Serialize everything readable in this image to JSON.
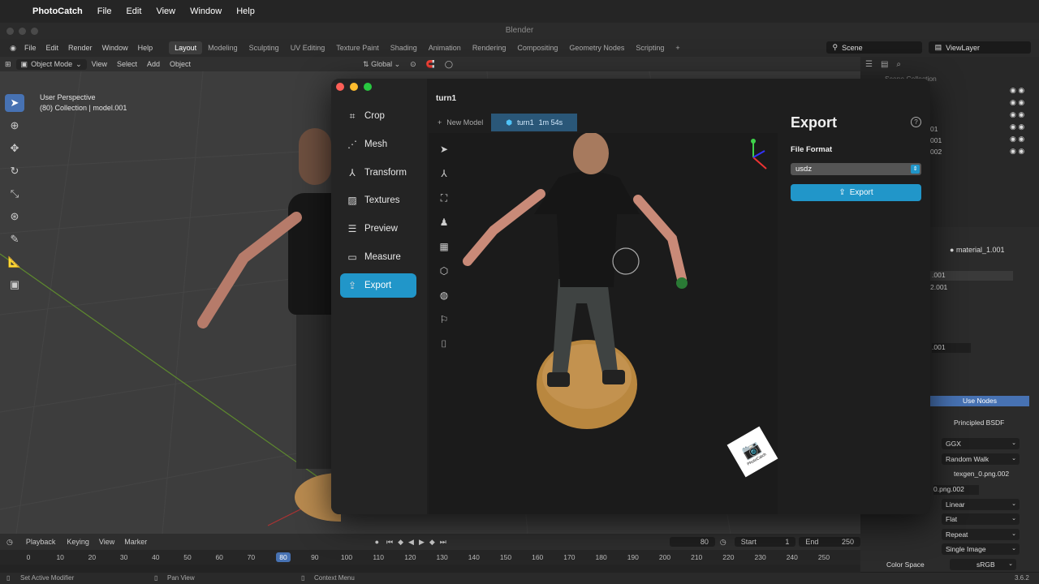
{
  "mac": {
    "app_name": "PhotoCatch",
    "menu": [
      "File",
      "Edit",
      "View",
      "Window",
      "Help"
    ]
  },
  "blender": {
    "window_title": "Blender",
    "menu": [
      "File",
      "Edit",
      "Render",
      "Window",
      "Help"
    ],
    "workspaces": [
      "Layout",
      "Modeling",
      "Sculpting",
      "UV Editing",
      "Texture Paint",
      "Shading",
      "Animation",
      "Rendering",
      "Compositing",
      "Geometry Nodes",
      "Scripting"
    ],
    "active_workspace": "Layout",
    "scene": "Scene",
    "view_layer": "ViewLayer",
    "viewport_header": {
      "mode": "Object Mode",
      "menus": [
        "View",
        "Select",
        "Add",
        "Object"
      ],
      "orientation": "Global"
    },
    "viewport_info": {
      "line1": "User Perspective",
      "line2": "(80) Collection | model.001"
    },
    "outliner": {
      "title": "Scene Collection",
      "rows": [
        "01",
        "001",
        "002"
      ]
    },
    "properties": {
      "material": "material_1.001",
      "slots": [
        ".001",
        "2.001"
      ],
      "material_field": ".001",
      "use_nodes": "Use Nodes",
      "surface": "Principled BSDF",
      "distribution": "GGX",
      "subsurface": "Random Walk",
      "image": "texgen_0.png.002",
      "image_field": "0.png.002",
      "interpolation": "Linear",
      "projection": "Flat",
      "extension": "Repeat",
      "source": "Single Image",
      "color_space_label": "Color Space",
      "color_space": "sRGB",
      "version": "3.6.2"
    },
    "timeline": {
      "menus": [
        "Playback",
        "Keying",
        "View",
        "Marker"
      ],
      "current_frame": "80",
      "start_label": "Start",
      "start": "1",
      "end_label": "End",
      "end": "250",
      "ticks": [
        "0",
        "10",
        "20",
        "30",
        "40",
        "50",
        "60",
        "70",
        "80",
        "90",
        "100",
        "110",
        "120",
        "130",
        "140",
        "150",
        "160",
        "170",
        "180",
        "190",
        "200",
        "210",
        "220",
        "230",
        "240",
        "250"
      ]
    },
    "status": {
      "left": "Set Active Modifier",
      "mid": "Pan View",
      "right": "Context Menu"
    }
  },
  "photocatch": {
    "project_title": "turn1",
    "nav": [
      "Crop",
      "Mesh",
      "Transform",
      "Textures",
      "Preview",
      "Measure",
      "Export"
    ],
    "active_nav": "Export",
    "tabs": {
      "new_model": "New Model",
      "active_model": "turn1",
      "active_time": "1m 54s"
    },
    "export": {
      "title": "Export",
      "file_format_label": "File Format",
      "file_format": "usdz",
      "button": "Export"
    },
    "logo_text": "PhotoCatch"
  },
  "colors": {
    "accent": "#2196c9",
    "blender_blue": "#4772b3",
    "traffic_red": "#fe5f57",
    "traffic_yellow": "#febc2e",
    "traffic_green": "#28c840"
  }
}
